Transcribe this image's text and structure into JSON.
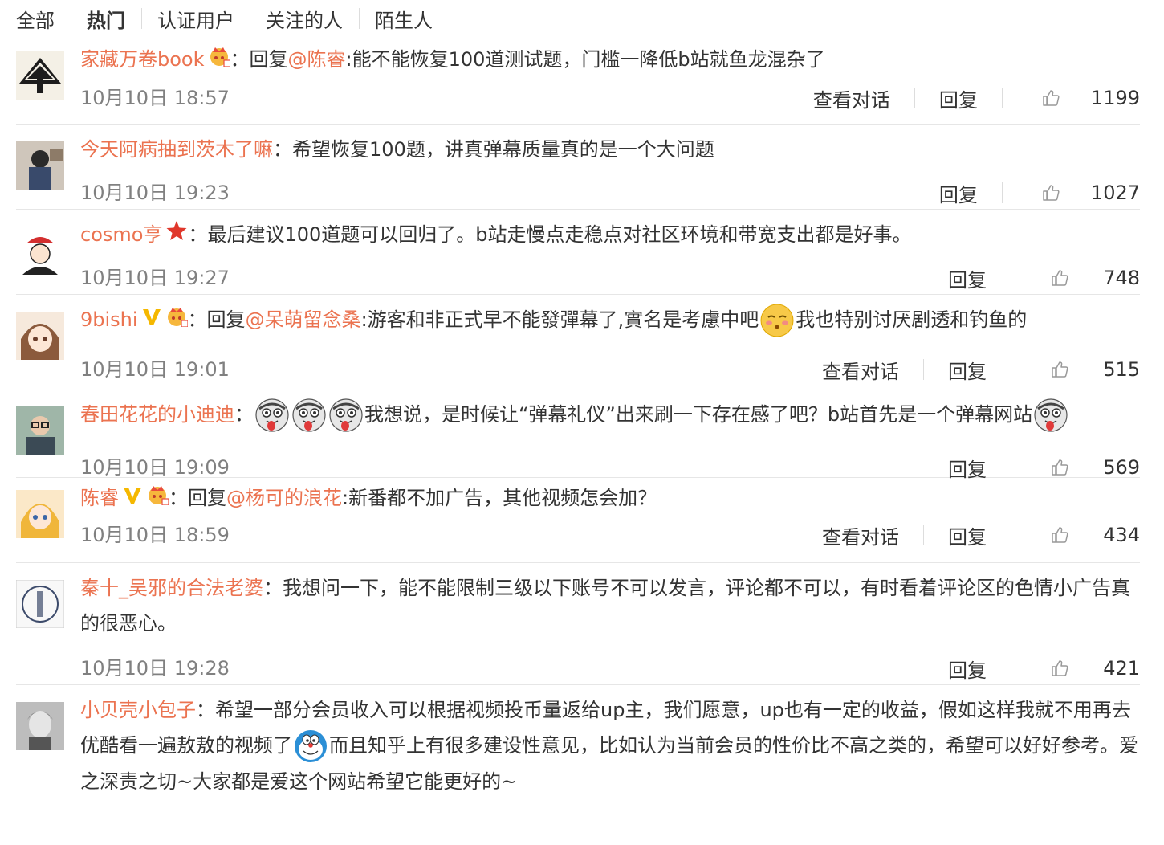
{
  "tabs": [
    {
      "label": "全部"
    },
    {
      "label": "热门",
      "active": true
    },
    {
      "label": "认证用户"
    },
    {
      "label": "关注的人"
    },
    {
      "label": "陌生人"
    }
  ],
  "colors": {
    "username": "#eb7350",
    "meta": "#808080",
    "divider": "#e6e6e6"
  },
  "comments": [
    {
      "user": "家藏万卷book",
      "badges": [
        "crown-badge-icon"
      ],
      "parts": [
        {
          "t": "text",
          "v": "："
        },
        {
          "t": "text",
          "v": "回复"
        },
        {
          "t": "mention",
          "v": "@陈睿"
        },
        {
          "t": "text",
          "v": ":能不能恢复100道测试题，门槛一降低b站就鱼龙混杂了"
        }
      ],
      "time": "10月10日 18:57",
      "view_dialog": "查看对话",
      "reply": "回复",
      "likes": "1199"
    },
    {
      "user": "今天阿病抽到茨木了嘛",
      "badges": [],
      "parts": [
        {
          "t": "text",
          "v": "：希望恢复100题，讲真弹幕质量真的是一个大问题"
        }
      ],
      "time": "10月10日 19:23",
      "reply": "回复",
      "likes": "1027"
    },
    {
      "user": "cosmo亨",
      "badges": [
        "red-star-icon"
      ],
      "parts": [
        {
          "t": "text",
          "v": "：最后建议100道题可以回归了。b站走慢点走稳点对社区环境和带宽支出都是好事。"
        }
      ],
      "time": "10月10日 19:27",
      "reply": "回复",
      "likes": "748"
    },
    {
      "user": "9bishi",
      "badges": [
        "verified-v-icon",
        "crown-badge-icon"
      ],
      "parts": [
        {
          "t": "text",
          "v": "：回复"
        },
        {
          "t": "mention",
          "v": "@呆萌留念桑"
        },
        {
          "t": "text",
          "v": ":游客和非正式早不能發彈幕了,實名是考慮中吧"
        },
        {
          "t": "emoji",
          "v": "shy-face-emoji"
        },
        {
          "t": "text",
          "v": "我也特别讨厌剧透和钓鱼的"
        }
      ],
      "time": "10月10日 19:01",
      "view_dialog": "查看对话",
      "reply": "回复",
      "likes": "515"
    },
    {
      "user": "春田花花的小迪迪",
      "badges": [],
      "parts": [
        {
          "t": "text",
          "v": "："
        },
        {
          "t": "emoji",
          "v": "tongue-face-emoji"
        },
        {
          "t": "emoji",
          "v": "tongue-face-emoji"
        },
        {
          "t": "emoji",
          "v": "tongue-face-emoji"
        },
        {
          "t": "text",
          "v": "我想说，是时候让“弹幕礼仪”出来刷一下存在感了吧？b站首先是一个弹幕网站"
        },
        {
          "t": "emoji",
          "v": "tongue-face-emoji"
        }
      ],
      "time": "10月10日 19:09",
      "reply": "回复",
      "likes": "569"
    },
    {
      "user": "陈睿",
      "badges": [
        "verified-v-icon",
        "crown-badge-icon"
      ],
      "parts": [
        {
          "t": "text",
          "v": "：回复"
        },
        {
          "t": "mention",
          "v": "@杨可的浪花"
        },
        {
          "t": "text",
          "v": ":新番都不加广告，其他视频怎会加？"
        }
      ],
      "time": "10月10日 18:59",
      "view_dialog": "查看对话",
      "reply": "回复",
      "likes": "434"
    },
    {
      "user": "秦十_吴邪的合法老婆",
      "badges": [],
      "parts": [
        {
          "t": "text",
          "v": "：我想问一下，能不能限制三级以下账号不可以发言，评论都不可以，有时看着评论区的色情小广告真的很恶心。"
        }
      ],
      "time": "10月10日 19:28",
      "reply": "回复",
      "likes": "421"
    },
    {
      "user": "小贝壳小包子",
      "badges": [],
      "parts": [
        {
          "t": "text",
          "v": "：希望一部分会员收入可以根据视频投币量返给up主，我们愿意，up也有一定的收益，假如这样我就不用再去优酷看一遍敖敖的视频了"
        },
        {
          "t": "emoji",
          "v": "doraemon-emoji"
        },
        {
          "t": "text",
          "v": "而且知乎上有很多建设性意见，比如认为当前会员的性价比不高之类的，希望可以好好参考。爱之深责之切~大家都是爱这个网站希望它能更好的~"
        }
      ]
    }
  ]
}
